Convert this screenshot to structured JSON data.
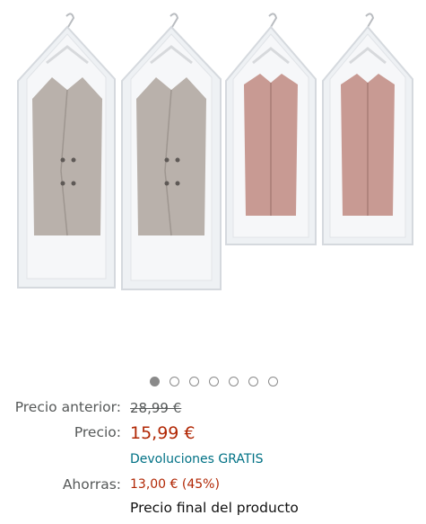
{
  "product_image": {
    "alt": "4 bolsas de vacío para colgar ropa con abrigos y chaquetas",
    "colors": {
      "bag": "#eef1f4",
      "coat_grey": "#b9b1ab",
      "coat_pink": "#c89a93",
      "hanger": "#d7d9dc"
    }
  },
  "carousel": {
    "total": 7,
    "active_index": 0
  },
  "pricing": {
    "old_price_label": "Precio anterior:",
    "old_price_value": "28,99 €",
    "price_label": "Precio:",
    "price_value": "15,99 €",
    "returns_link": "Devoluciones GRATIS",
    "savings_label": "Ahorras:",
    "savings_value": "13,00 € (45%)",
    "final_note": "Precio final del producto"
  },
  "colors": {
    "price_red": "#b12704",
    "link_teal": "#007185",
    "label_grey": "#565959"
  }
}
